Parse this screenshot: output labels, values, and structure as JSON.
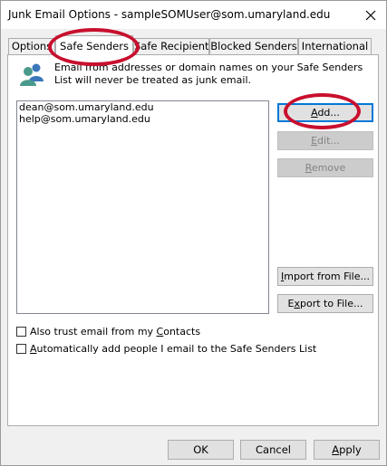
{
  "window": {
    "title": "Junk Email Options - sampleSOMUser@som.umaryland.edu"
  },
  "tabs": [
    {
      "label": "Options"
    },
    {
      "label": "Safe Senders"
    },
    {
      "label": "Safe Recipients"
    },
    {
      "label": "Blocked Senders"
    },
    {
      "label": "International"
    }
  ],
  "active_tab": "Safe Senders",
  "description": "Email from addresses or domain names on your Safe Senders List will never be treated as junk email.",
  "list": {
    "items": [
      "dean@som.umaryland.edu",
      "help@som.umaryland.edu"
    ]
  },
  "buttons": {
    "add": {
      "pre": "",
      "key": "A",
      "post": "dd..."
    },
    "edit": {
      "pre": "",
      "key": "E",
      "post": "dit..."
    },
    "remove": {
      "pre": "",
      "key": "R",
      "post": "emove"
    },
    "import": {
      "pre": "",
      "key": "I",
      "post": "mport from File..."
    },
    "export": {
      "pre": "E",
      "key": "x",
      "post": "port to File..."
    }
  },
  "checkboxes": {
    "trust_contacts": {
      "pre": "Also trust email from my ",
      "key": "C",
      "post": "ontacts",
      "checked": false
    },
    "auto_add": {
      "pre": "",
      "key": "A",
      "post": "utomatically add people I email to the Safe Senders List",
      "checked": false
    }
  },
  "footer": {
    "ok": "OK",
    "cancel": "Cancel",
    "apply_key": "A",
    "apply_rest": "pply"
  },
  "colors": {
    "annotation": "#c8102e",
    "accent": "#0078d7"
  }
}
